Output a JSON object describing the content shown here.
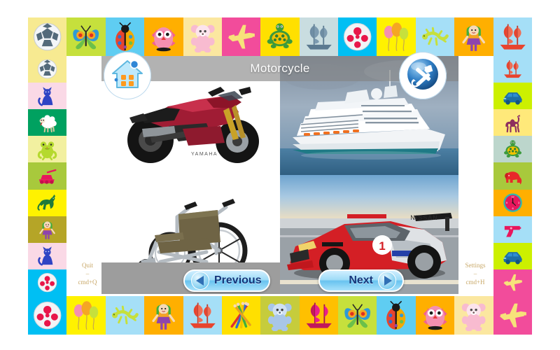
{
  "app": {
    "title": "Motorcycle"
  },
  "corner_buttons": {
    "home": {
      "name": "home-button",
      "icon": "home-icon"
    },
    "settings": {
      "name": "settings-button",
      "icon": "tools-icon"
    }
  },
  "nav": {
    "previous_label": "Previous",
    "next_label": "Next"
  },
  "hints": {
    "quit": {
      "label": "Quit",
      "separator": "–",
      "shortcut": "cmd+Q"
    },
    "settings": {
      "label": "Settings",
      "separator": "–",
      "shortcut": "cmd+H"
    }
  },
  "stage": {
    "quadrants": [
      {
        "name": "motorcycle-image",
        "subject": "motorcycle",
        "position": "top-left"
      },
      {
        "name": "cruise-ship-image",
        "subject": "cruise ship",
        "position": "top-right"
      },
      {
        "name": "wheelchair-image",
        "subject": "wheelchair",
        "position": "bottom-left"
      },
      {
        "name": "race-car-image",
        "subject": "race car",
        "position": "bottom-right"
      }
    ]
  },
  "colors": {
    "title_bar": "#828282",
    "stage_background": "#9d9d9d",
    "nav_button": "#9fdcf7",
    "nav_label": "#14357a",
    "hint_text": "#c9a96a"
  },
  "border": {
    "top": [
      {
        "icon": "soccer-ball-icon",
        "bg": "#f7ea91"
      },
      {
        "icon": "butterfly-icon",
        "bg": "#c6e03c"
      },
      {
        "icon": "ladybug-icon",
        "bg": "#5fcdf2"
      },
      {
        "icon": "owl-icon",
        "bg": "#ffaf00"
      },
      {
        "icon": "teddy-bear-icon",
        "bg": "#fbe7a0"
      },
      {
        "icon": "airplane-icon",
        "bg": "#f24c9b"
      },
      {
        "icon": "turtle-icon",
        "bg": "#ffe000"
      },
      {
        "icon": "sailing-ship-icon",
        "bg": "#c9dde0"
      },
      {
        "icon": "spotted-ball-icon",
        "bg": "#00bff3"
      },
      {
        "icon": "balloons-icon",
        "bg": "#fff200"
      },
      {
        "icon": "lizard-icon",
        "bg": "#a5dff7"
      },
      {
        "icon": "girl-doll-icon",
        "bg": "#ffaf00"
      },
      {
        "icon": "red-ship-icon",
        "bg": "#a5dff7"
      }
    ],
    "bottom": [
      {
        "icon": "spotted-ball-icon",
        "bg": "#00bff3"
      },
      {
        "icon": "balloons-icon",
        "bg": "#fff200"
      },
      {
        "icon": "lizard-icon",
        "bg": "#a5dff7"
      },
      {
        "icon": "girl-doll-icon",
        "bg": "#ffaf00"
      },
      {
        "icon": "red-ship-icon",
        "bg": "#a5dff7"
      },
      {
        "icon": "pencils-icon",
        "bg": "#ffe000"
      },
      {
        "icon": "blue-bear-icon",
        "bg": "#c6cc3c"
      },
      {
        "icon": "magenta-ship-icon",
        "bg": "#ffc000"
      },
      {
        "icon": "butterfly-icon",
        "bg": "#c6e03c"
      },
      {
        "icon": "ladybug-icon",
        "bg": "#5fcdf2"
      },
      {
        "icon": "owl-icon",
        "bg": "#ffaf00"
      },
      {
        "icon": "teddy-bear-icon",
        "bg": "#fbe7a0"
      },
      {
        "icon": "airplane-icon",
        "bg": "#f24c9b"
      }
    ],
    "left": [
      {
        "icon": "soccer-ball-icon",
        "bg": "#f7ea91"
      },
      {
        "icon": "blue-cat-icon",
        "bg": "#fad9e6"
      },
      {
        "icon": "sheep-icon",
        "bg": "#00a160"
      },
      {
        "icon": "green-frog-icon",
        "bg": "#f2f0a0"
      },
      {
        "icon": "pink-tank-icon",
        "bg": "#a8c93c"
      },
      {
        "icon": "green-horse-icon",
        "bg": "#fff200"
      },
      {
        "icon": "girl-doll-icon",
        "bg": "#b5a527"
      },
      {
        "icon": "blue-cat-icon",
        "bg": "#fad9e6"
      },
      {
        "icon": "spotted-ball-icon",
        "bg": "#00bff3"
      }
    ],
    "right": [
      {
        "icon": "red-ship-icon",
        "bg": "#a5dff7"
      },
      {
        "icon": "blue-car-icon",
        "bg": "#ccf000"
      },
      {
        "icon": "camel-icon",
        "bg": "#ffe97a"
      },
      {
        "icon": "turtle-icon",
        "bg": "#bcd6cc"
      },
      {
        "icon": "red-elephant-icon",
        "bg": "#a8c93c"
      },
      {
        "icon": "clock-icon",
        "bg": "#ffaf00"
      },
      {
        "icon": "pink-gun-icon",
        "bg": "#a5dff7"
      },
      {
        "icon": "blue-car-icon",
        "bg": "#ccf000"
      },
      {
        "icon": "airplane-icon",
        "bg": "#f24c9b"
      }
    ]
  }
}
